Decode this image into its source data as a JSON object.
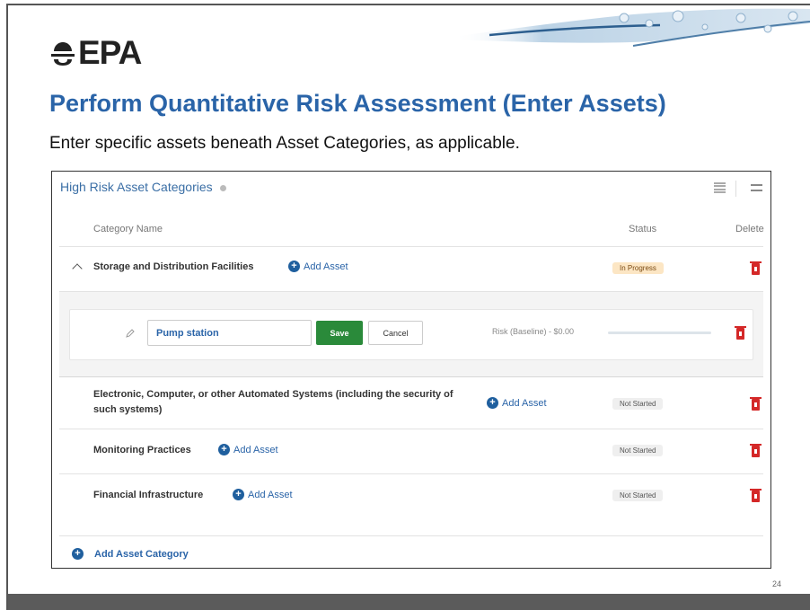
{
  "slide": {
    "logo_text": "EPA",
    "title": "Perform Quantitative Risk Assessment (Enter Assets)",
    "subtitle": "Enter specific assets beneath Asset Categories, as applicable.",
    "page_number": "24"
  },
  "panel": {
    "title": "High Risk Asset Categories",
    "columns": {
      "name": "Category Name",
      "status": "Status",
      "delete": "Delete"
    },
    "categories": [
      {
        "name": "Storage and Distribution Facilities",
        "add_label": "Add Asset",
        "status": "In Progress",
        "expanded": true
      },
      {
        "name": "Electronic, Computer, or other Automated Systems (including the security of such systems)",
        "add_label": "Add Asset",
        "status": "Not Started"
      },
      {
        "name": "Monitoring Practices",
        "add_label": "Add Asset",
        "status": "Not Started"
      },
      {
        "name": "Financial Infrastructure",
        "add_label": "Add Asset",
        "status": "Not Started"
      }
    ],
    "asset_editor": {
      "value": "Pump station",
      "save_label": "Save",
      "cancel_label": "Cancel",
      "risk_label": "Risk (Baseline) - $0.00"
    },
    "add_category_label": "Add Asset Category"
  },
  "colors": {
    "title_blue": "#2a64a8",
    "save_green": "#2a8a3a",
    "delete_red": "#d42828",
    "in_progress_bg": "#fce6c4"
  },
  "icons": [
    "epa-flower-icon",
    "info-icon",
    "list-view-icon",
    "compact-view-icon",
    "chevron-up-icon",
    "plus-circle-icon",
    "pencil-icon",
    "trash-icon"
  ]
}
